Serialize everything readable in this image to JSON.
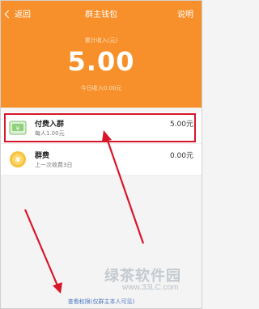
{
  "nav": {
    "back_label": "返回",
    "title": "群主钱包",
    "help_label": "说明"
  },
  "summary": {
    "caption": "累计收入(元)",
    "amount": "5.00",
    "today": "今日收入0.00元"
  },
  "rows": [
    {
      "name": "付费入群",
      "sub": "每人1.00元",
      "value": "5.00元",
      "icon": "paid-group-icon"
    },
    {
      "name": "群费",
      "sub": "上一次收费3日",
      "value": "0.00元",
      "icon": "group-fee-icon"
    }
  ],
  "footer": {
    "link_label": "查看权限(仅群主本人可见)"
  },
  "watermark": {
    "text": "绿茶软件园",
    "url": "www.33LC.com"
  },
  "colors": {
    "header": "#f7902a",
    "highlight": "#d8162a"
  }
}
